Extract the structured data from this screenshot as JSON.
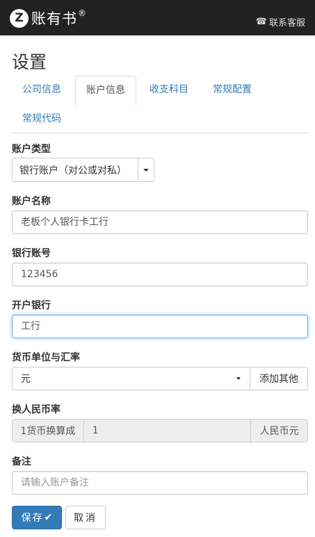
{
  "header": {
    "logo_glyph": "Z",
    "brand_name": "账有书",
    "brand_mark": "®",
    "service_icon": "phone-icon",
    "service_label": "联系客服"
  },
  "page": {
    "title": "设置"
  },
  "tabs": [
    {
      "label": "公司信息",
      "active": false
    },
    {
      "label": "账户信息",
      "active": true
    },
    {
      "label": "收支科目",
      "active": false
    },
    {
      "label": "常规配置",
      "active": false
    },
    {
      "label": "常规代码",
      "active": false
    }
  ],
  "form": {
    "account_type": {
      "label": "账户类型",
      "value": "银行账户（对公或对私）"
    },
    "account_name": {
      "label": "账户名称",
      "value": "老板个人银行卡工行"
    },
    "bank_account": {
      "label": "银行账号",
      "value": "123456"
    },
    "opening_bank": {
      "label": "开户银行",
      "value": "工行"
    },
    "currency": {
      "label": "货币单位与汇率",
      "value": "元",
      "add_button": "添加其他"
    },
    "exchange_rate": {
      "label": "换人民币率",
      "prefix": "1货币换算成",
      "value": "1",
      "suffix": "人民币元"
    },
    "remark": {
      "label": "备注",
      "placeholder": "请输入账户备注",
      "value": ""
    }
  },
  "actions": {
    "save_label": "保存",
    "cancel_label": "取消"
  },
  "colors": {
    "topbar": "#222222",
    "primary": "#337ab7",
    "link": "#337ab7",
    "focus_border": "#66afe9"
  }
}
